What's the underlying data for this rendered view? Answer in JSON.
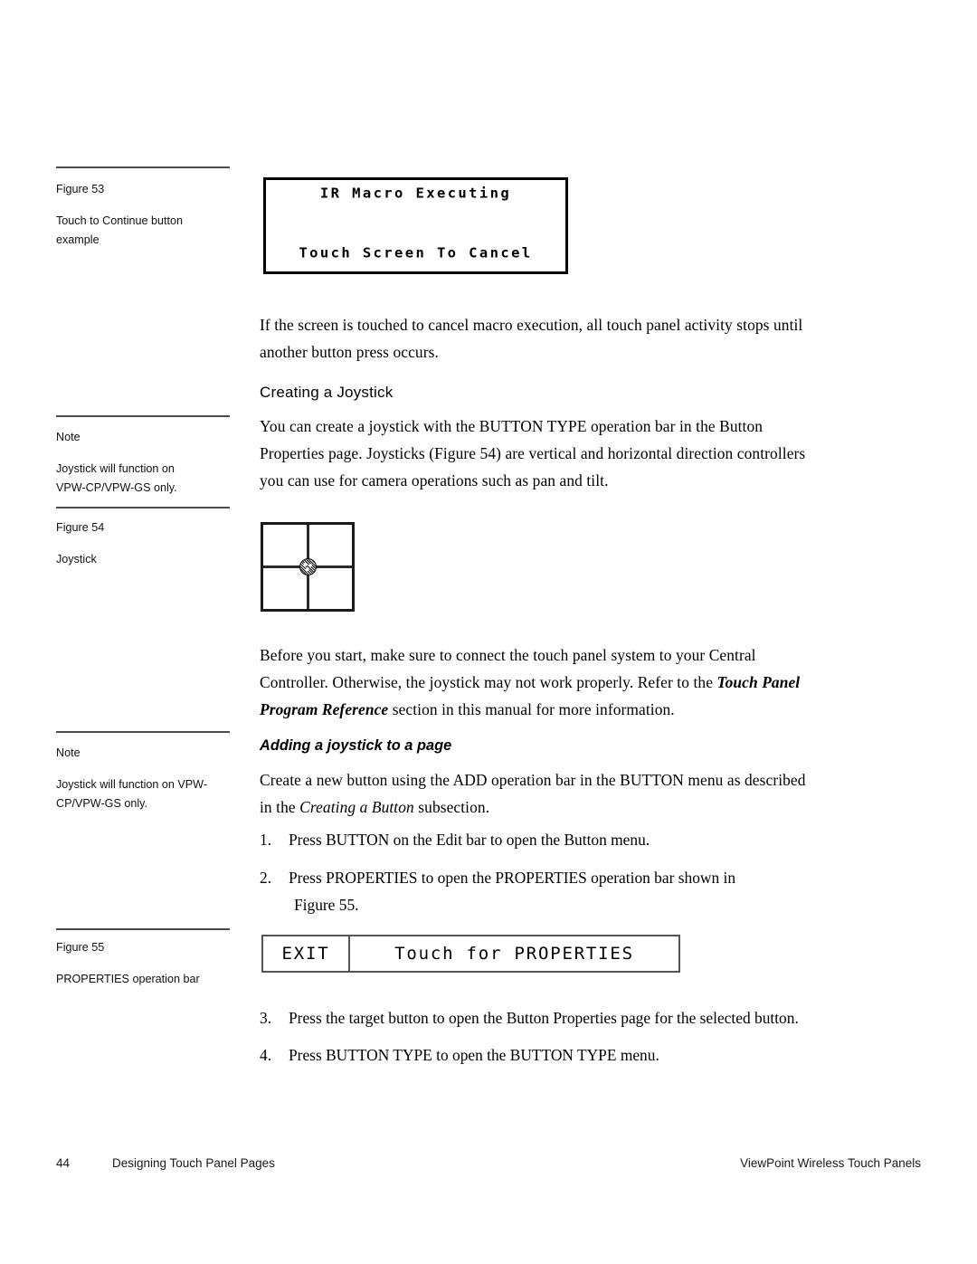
{
  "document": {
    "page_number": "44",
    "footer_section": "Designing Touch Panel Pages",
    "footer_title": "ViewPoint Wireless Touch Panels"
  },
  "sidebar": {
    "fig53": {
      "label": "Figure 53",
      "caption_line1": "Touch to Continue button",
      "caption_line2": "example"
    },
    "note1": {
      "label": "Note",
      "text_line1": "Joystick will function on",
      "text_line2": "VPW-CP/VPW-GS only."
    },
    "fig54": {
      "label": "Figure 54",
      "caption_line1": "Joystick"
    },
    "note2": {
      "label": "Note",
      "text_line1": "Joystick will function on VPW-",
      "text_line2": "CP/VPW-GS only."
    },
    "fig55": {
      "label": "Figure 55",
      "caption_line1": "PROPERTIES operation bar"
    }
  },
  "figures": {
    "touch_screen": {
      "line1": "IR Macro Executing",
      "line2": "Touch Screen To Cancel"
    },
    "properties_bar": {
      "exit_label": "EXIT",
      "main_label": "Touch for PROPERTIES"
    }
  },
  "main": {
    "para_cancel": {
      "line1": "If the screen is touched to cancel macro execution, all touch panel activity stops until",
      "line2": "another button press occurs."
    },
    "heading_creating_joystick": "Creating a Joystick",
    "para_create": {
      "line1": "You can create a joystick with the BUTTON TYPE operation bar in the Button",
      "line2": "Properties page. Joysticks (Figure 54) are vertical and horizontal direction controllers",
      "line3": "you can use for camera operations such as pan and tilt."
    },
    "para_before": {
      "line1": "Before you start, make sure to connect the touch panel system to your Central",
      "line2a": "Controller. Otherwise, the joystick may not work properly. Refer to the ",
      "line2b": "Touch Panel",
      "line3a": "Program Reference",
      "line3b": " section in this manual for more information."
    },
    "heading_adding_joystick": "Adding a joystick to a page",
    "para_add": {
      "line1": "Create a new button using the ADD operation bar in the BUTTON menu as described",
      "line2a": "in the ",
      "line2b": "Creating a Button",
      "line2c": " subsection."
    },
    "steps": [
      {
        "number": "1.",
        "line1": "Press BUTTON on the Edit bar to open the Button menu.",
        "line2": ""
      },
      {
        "number": "2.",
        "line1": "Press PROPERTIES to open the PROPERTIES operation bar shown in",
        "line2": "Figure 55."
      },
      {
        "number": "3.",
        "line1": "Press the target button to open the Button Properties page for the selected button.",
        "line2": ""
      },
      {
        "number": "4.",
        "line1": "Press BUTTON TYPE to open the BUTTON TYPE menu.",
        "line2": ""
      }
    ]
  }
}
